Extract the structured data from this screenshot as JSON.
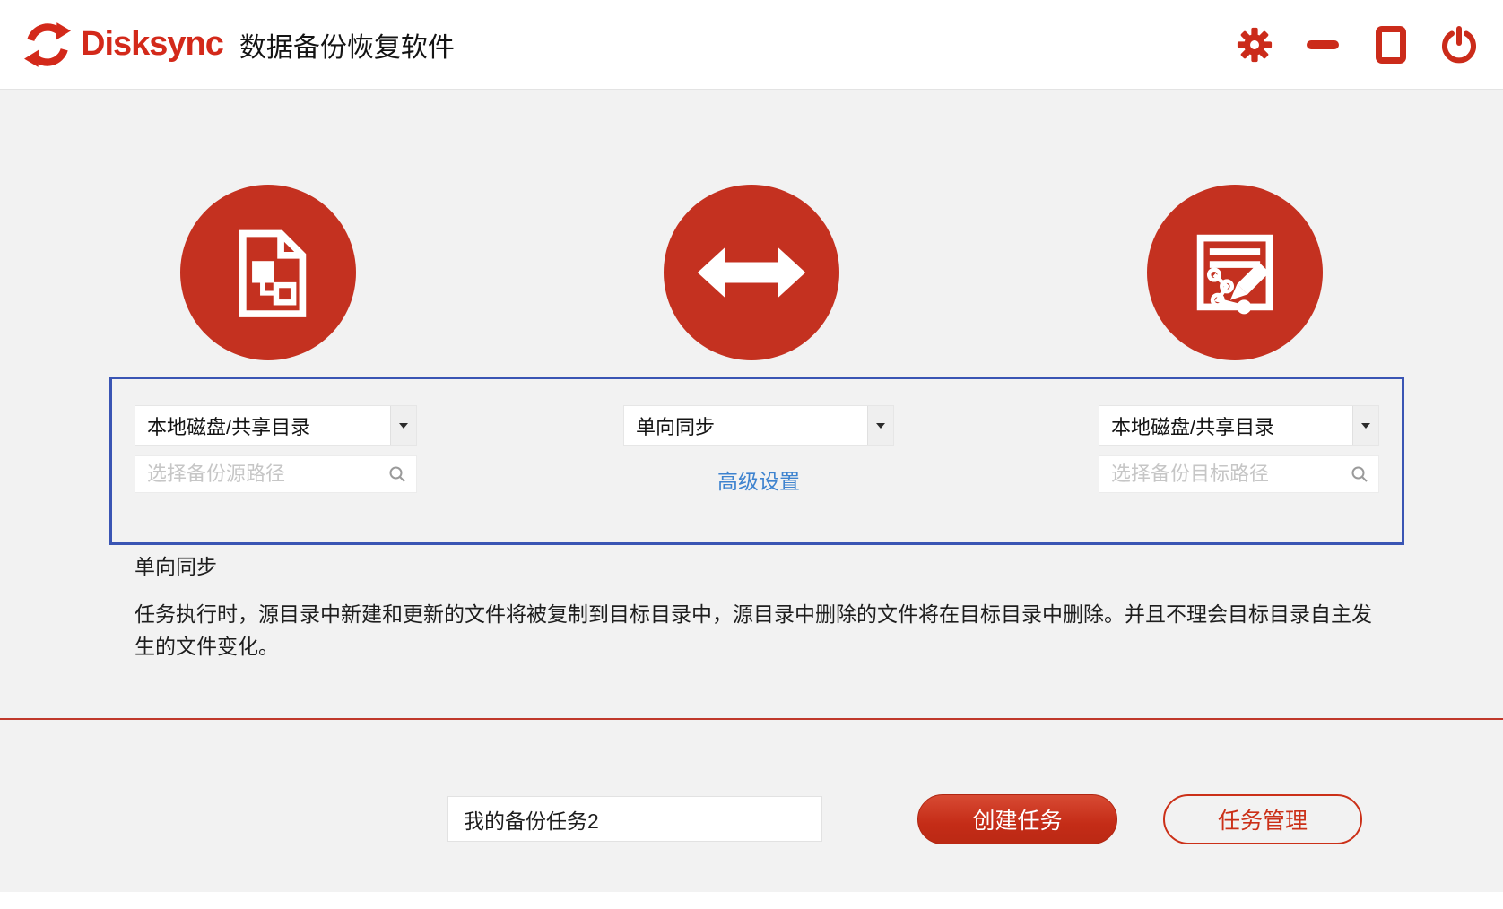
{
  "header": {
    "brand": "Disksync",
    "title": "数据备份恢复软件"
  },
  "icons": {
    "logo": "sync-arrows",
    "settings": "gear",
    "minimize": "minus-bar",
    "maximize": "square-outline",
    "power": "power-symbol",
    "search": "magnifier",
    "dropdown_caret": "caret-down",
    "source_circle": "file-tree-document",
    "mode_circle": "double-headed-arrow",
    "target_circle": "document-edit-pencil"
  },
  "wizard": {
    "source": {
      "type_selected": "本地磁盘/共享目录",
      "path_placeholder": "选择备份源路径"
    },
    "mode": {
      "type_selected": "单向同步",
      "advanced_link": "高级设置"
    },
    "target": {
      "type_selected": "本地磁盘/共享目录",
      "path_placeholder": "选择备份目标路径"
    }
  },
  "mode_info": {
    "title": "单向同步",
    "description": "任务执行时，源目录中新建和更新的文件将被复制到目标目录中，源目录中删除的文件将在目标目录中删除。并且不理会目标目录自主发生的文件变化。"
  },
  "footer": {
    "task_name_value": "我的备份任务2",
    "create_button": "创建任务",
    "manage_button": "任务管理"
  },
  "colors": {
    "accent_red": "#cb2f1b",
    "circle_red": "#c43120",
    "link_blue": "#3e83cf",
    "panel_border_blue": "#3a55b4",
    "divider_red": "#c0392b",
    "background_gray": "#f2f2f2"
  }
}
